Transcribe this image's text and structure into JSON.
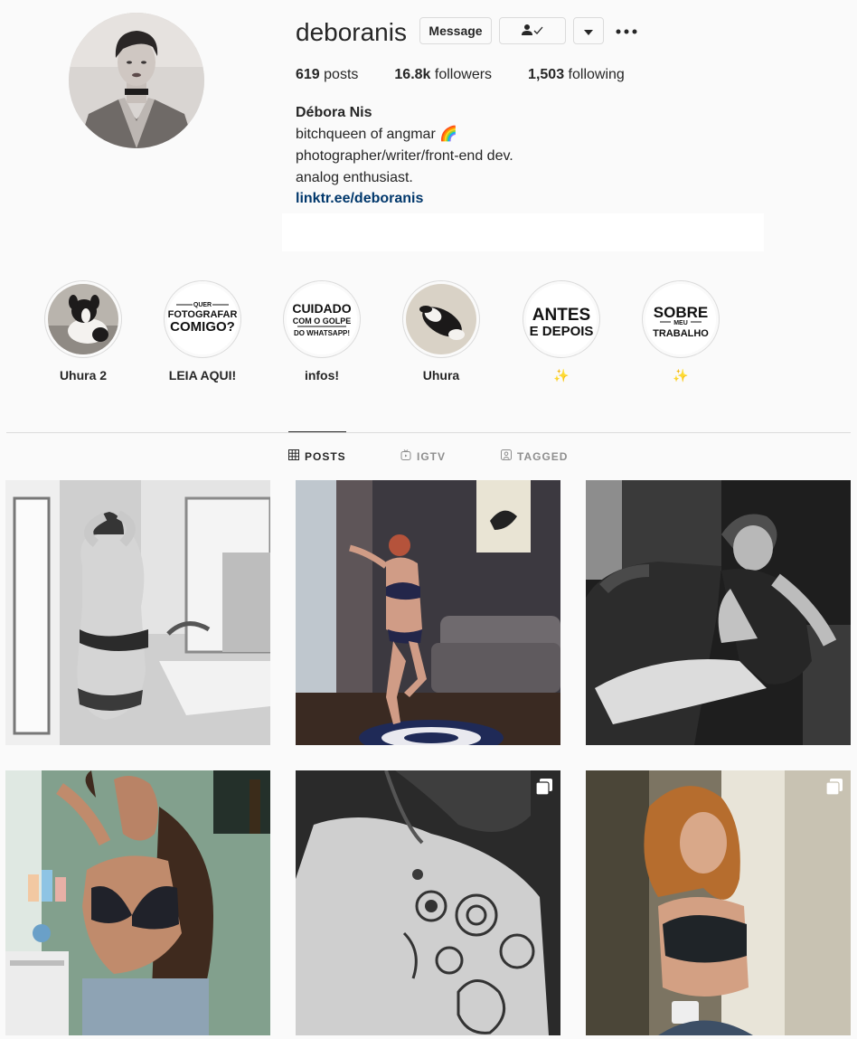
{
  "profile": {
    "username": "deboranis",
    "message_label": "Message",
    "follow_icon": "person-check-icon",
    "caret_icon": "caret-down-icon",
    "more_icon": "more-horizontal-icon",
    "avatar": "profile-avatar"
  },
  "stats": {
    "posts_count": "619",
    "posts_label": "posts",
    "followers_count": "16.8k",
    "followers_label": "followers",
    "following_count": "1,503",
    "following_label": "following"
  },
  "bio": {
    "full_name": "Débora Nis",
    "lines": [
      "bitchqueen of angmar 🌈",
      "photographer/writer/front-end dev.",
      "analog enthusiast."
    ],
    "link": "linktr.ee/deboranis"
  },
  "highlights": [
    {
      "label": "Uhura 2",
      "kind": "photo"
    },
    {
      "label": "LEIA AQUI!",
      "kind": "text",
      "art_lines": [
        "QUER",
        "FOTOGRAFAR",
        "COMIGO?"
      ]
    },
    {
      "label": "infos!",
      "kind": "text",
      "art_lines": [
        "CUIDADO",
        "COM O GOLPE",
        "DO WHATSAPP!"
      ]
    },
    {
      "label": "Uhura",
      "kind": "photo"
    },
    {
      "label": "✨",
      "kind": "text",
      "art_lines": [
        "ANTES",
        "E DEPOIS"
      ]
    },
    {
      "label": "✨",
      "kind": "text",
      "art_lines": [
        "SOBRE",
        "MEU",
        "TRABALHO"
      ]
    }
  ],
  "tabs": [
    {
      "label": "POSTS",
      "icon": "grid-icon",
      "active": true
    },
    {
      "label": "IGTV",
      "icon": "igtv-icon",
      "active": false
    },
    {
      "label": "TAGGED",
      "icon": "tagged-icon",
      "active": false
    }
  ],
  "posts": [
    {
      "id": 1,
      "multi": false
    },
    {
      "id": 2,
      "multi": false
    },
    {
      "id": 3,
      "multi": false
    },
    {
      "id": 4,
      "multi": false
    },
    {
      "id": 5,
      "multi": true
    },
    {
      "id": 6,
      "multi": true
    }
  ],
  "colors": {
    "background": "#fafafa",
    "text": "#262626",
    "muted": "#8e8e8e",
    "border": "#dbdbdb",
    "link": "#00376b"
  }
}
